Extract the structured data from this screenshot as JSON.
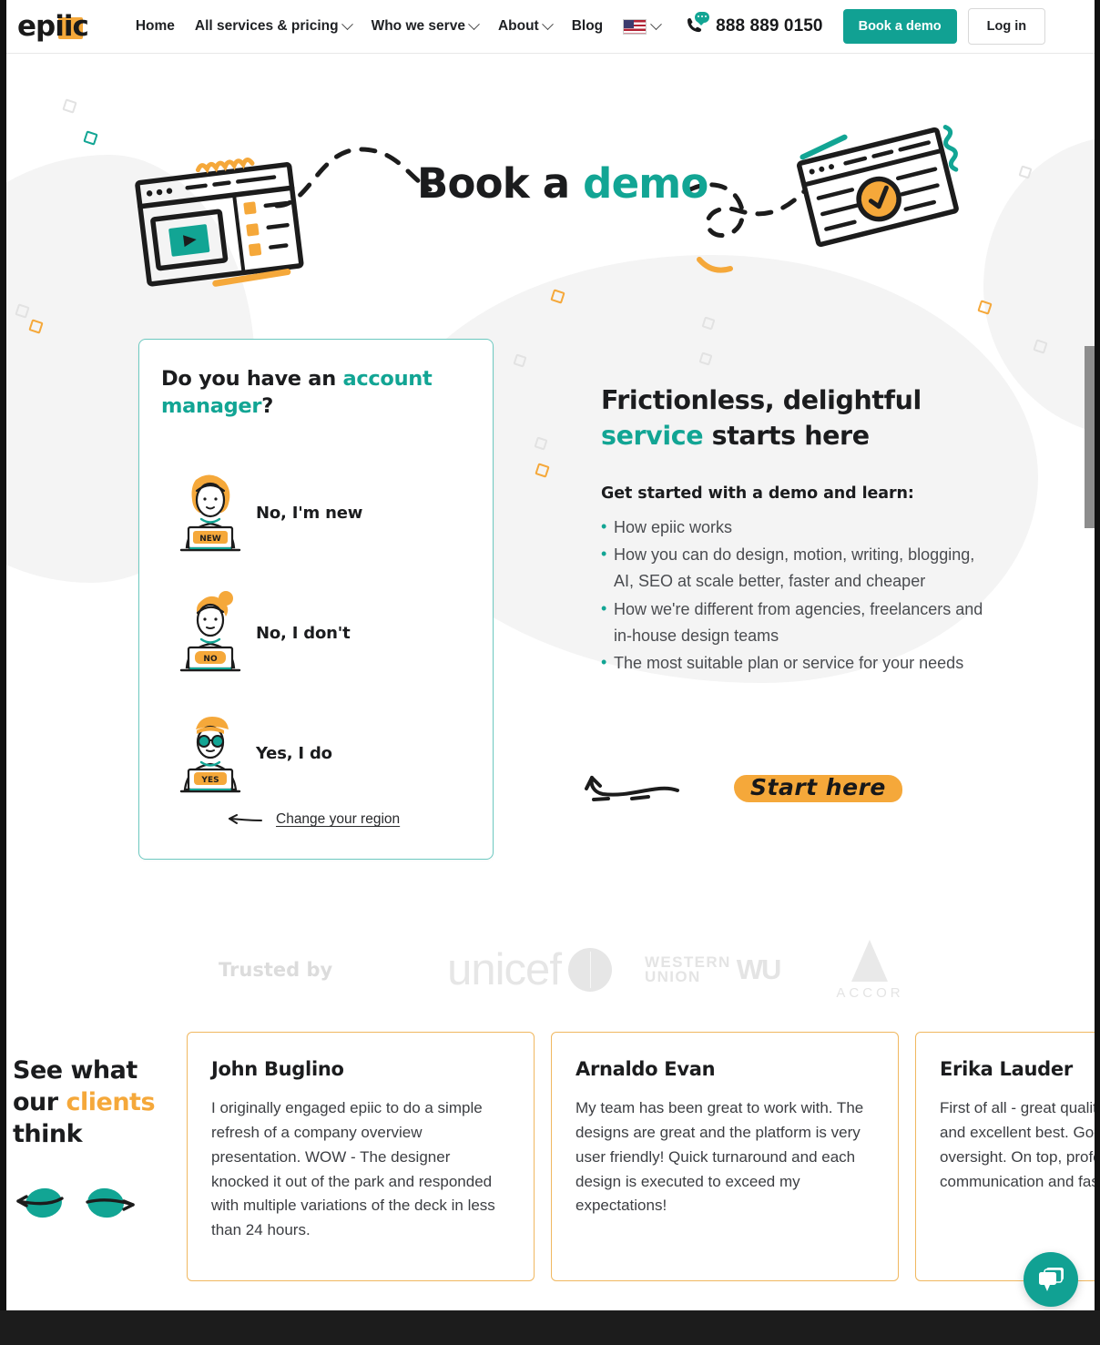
{
  "nav": {
    "logo_text": "epiic",
    "items": [
      {
        "label": "Home",
        "has_dropdown": false
      },
      {
        "label": "All services & pricing",
        "has_dropdown": true
      },
      {
        "label": "Who we serve",
        "has_dropdown": true
      },
      {
        "label": "About",
        "has_dropdown": true
      },
      {
        "label": "Blog",
        "has_dropdown": false
      }
    ],
    "locale_flag": "us-flag-icon",
    "phone": "888 889 0150",
    "book_demo_label": "Book a demo",
    "login_label": "Log in"
  },
  "hero": {
    "title_part1": "Book a ",
    "title_accent": "demo"
  },
  "card": {
    "heading_part1": "Do you have an ",
    "heading_accent": "account manager",
    "heading_part2": "?",
    "options": [
      {
        "label": "No, I'm new",
        "badge": "NEW"
      },
      {
        "label": "No, I don't",
        "badge": "NO"
      },
      {
        "label": "Yes, I do",
        "badge": "YES"
      }
    ],
    "change_region_label": "Change your region"
  },
  "right_column": {
    "heading_part1": "Frictionless, delightful",
    "heading_accent": "service",
    "heading_part2": " starts here",
    "subheading": "Get started with a demo and learn:",
    "bullets": [
      "How epiic works",
      "How you can do design, motion, writing, blogging, AI, SEO at scale better, faster and cheaper",
      "How we're different from agencies, freelancers and in-house design teams",
      "The most suitable plan or service for your needs"
    ],
    "start_here_label": "Start here"
  },
  "trusted": {
    "label": "Trusted by",
    "logos": [
      {
        "name": "unicef",
        "text": "unicef"
      },
      {
        "name": "western-union",
        "line1": "WESTERN",
        "line2": "UNION",
        "mark": "WU"
      },
      {
        "name": "accor",
        "text": "ACCOR"
      }
    ]
  },
  "testimonials": {
    "heading_part1": "See what our ",
    "heading_accent": "clients",
    "heading_part2": " think",
    "prev_label": "previous",
    "next_label": "next",
    "cards": [
      {
        "name": "John Buglino",
        "quote": "I originally engaged epiic to do a simple refresh of a company overview presentation. WOW - The designer knocked it out of the park and responded with multiple variations of the deck in less than 24 hours."
      },
      {
        "name": "Arnaldo Evan",
        "quote": "My team has been great to work with. The designs are great and the platform is very user friendly! Quick turnaround and each design is executed to exceed my expectations!"
      },
      {
        "name": "Erika Lauder",
        "quote": "First of all - great quality design services and excellent best. Good designers with oversight. On top, professional communication and fast delivery."
      }
    ]
  },
  "chat": {
    "label": "chat-widget"
  },
  "colors": {
    "teal": "#11a193",
    "orange": "#f5a83a",
    "dark": "#1b1c1e",
    "body_text": "#4a4c50",
    "card_border": "#6dc9c0",
    "testimonial_border": "#f0b860"
  }
}
